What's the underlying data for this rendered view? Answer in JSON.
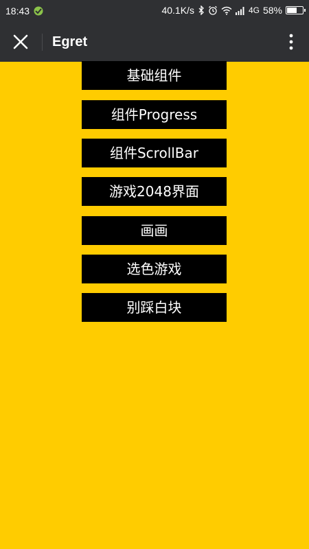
{
  "status_bar": {
    "time": "18:43",
    "network_speed": "40.1K/s",
    "network_type": "4G",
    "battery_percent": "58%",
    "battery_level": 0.58,
    "icons": [
      "bluetooth-icon",
      "alarm-icon",
      "wifi-icon",
      "signal-icon",
      "battery-icon"
    ]
  },
  "title_bar": {
    "title": "Egret",
    "close_icon": "close-icon",
    "more_icon": "more-vertical-icon"
  },
  "menu": {
    "items": [
      {
        "label": "基础组件"
      },
      {
        "label": "组件Progress"
      },
      {
        "label": "组件ScrollBar"
      },
      {
        "label": "游戏2048界面"
      },
      {
        "label": "画画"
      },
      {
        "label": "选色游戏"
      },
      {
        "label": "别踩白块"
      }
    ]
  },
  "colors": {
    "background": "#ffcc00",
    "title_bar": "#2f3033",
    "button": "#000000",
    "button_text": "#ffffff"
  }
}
